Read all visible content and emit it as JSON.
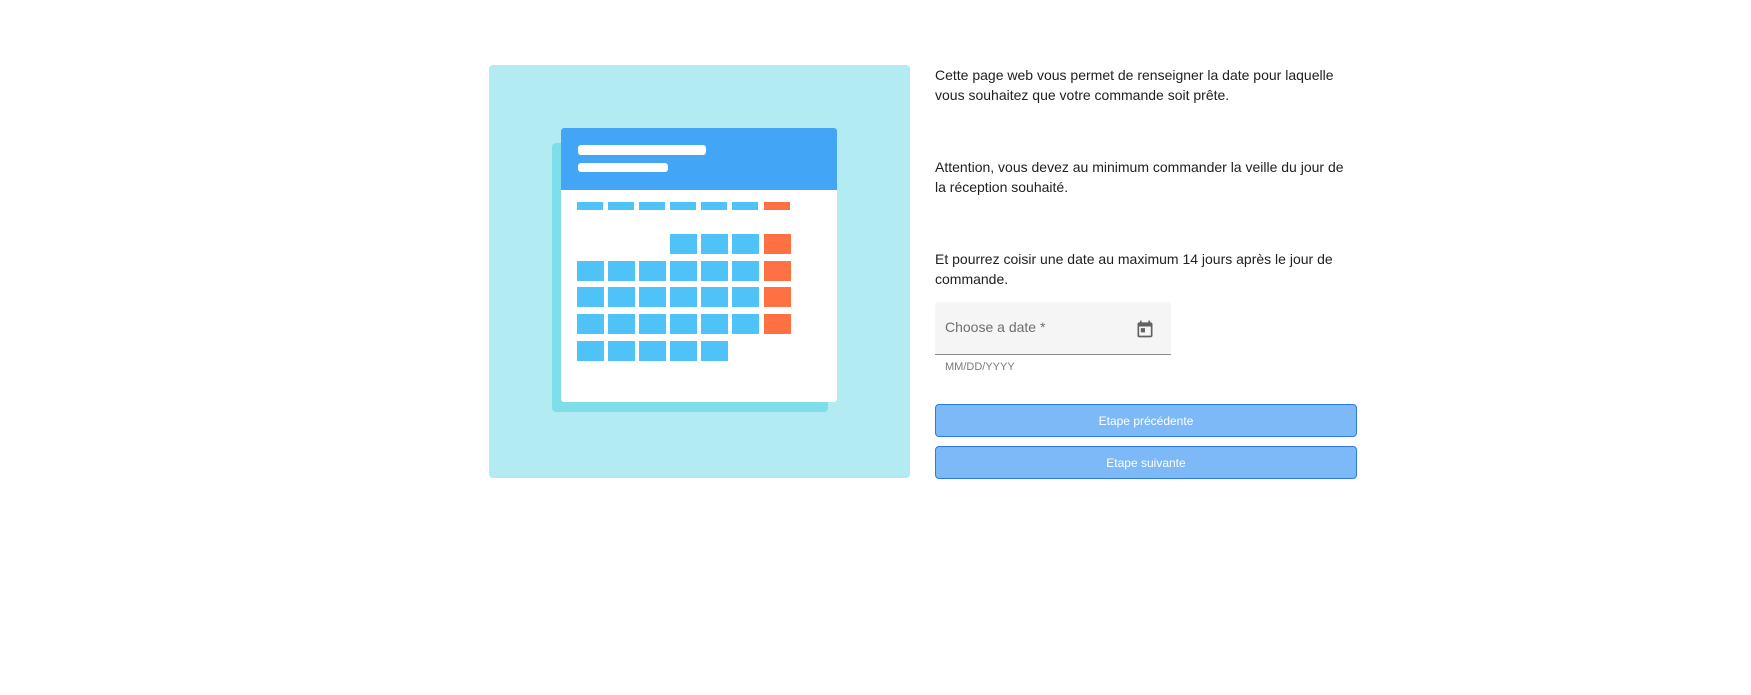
{
  "illustration": {
    "name": "calendar-illustration",
    "colors": {
      "background": "#b3ebf2",
      "shadow": "#80deea",
      "header": "#42a5f5",
      "day": "#4fc3f7",
      "weekend": "#ff7043",
      "page": "#ffffff"
    }
  },
  "content": {
    "paragraphs": [
      "Cette page web vous permet de renseigner la date pour laquelle vous souhaitez que votre commande soit prête.",
      "Attention, vous devez au minimum commander la veille du jour de la réception souhaité.",
      "Et pourrez coisir une date au maximum 14 jours après le jour de commande."
    ]
  },
  "date_field": {
    "label": "Choose a date *",
    "value": "",
    "hint": "MM/DD/YYYY",
    "icon": "calendar-icon"
  },
  "buttons": {
    "previous_label": "Etape précédente",
    "next_label": "Etape suivante",
    "color": "#7db8f7",
    "border_color": "#2f79e6"
  }
}
